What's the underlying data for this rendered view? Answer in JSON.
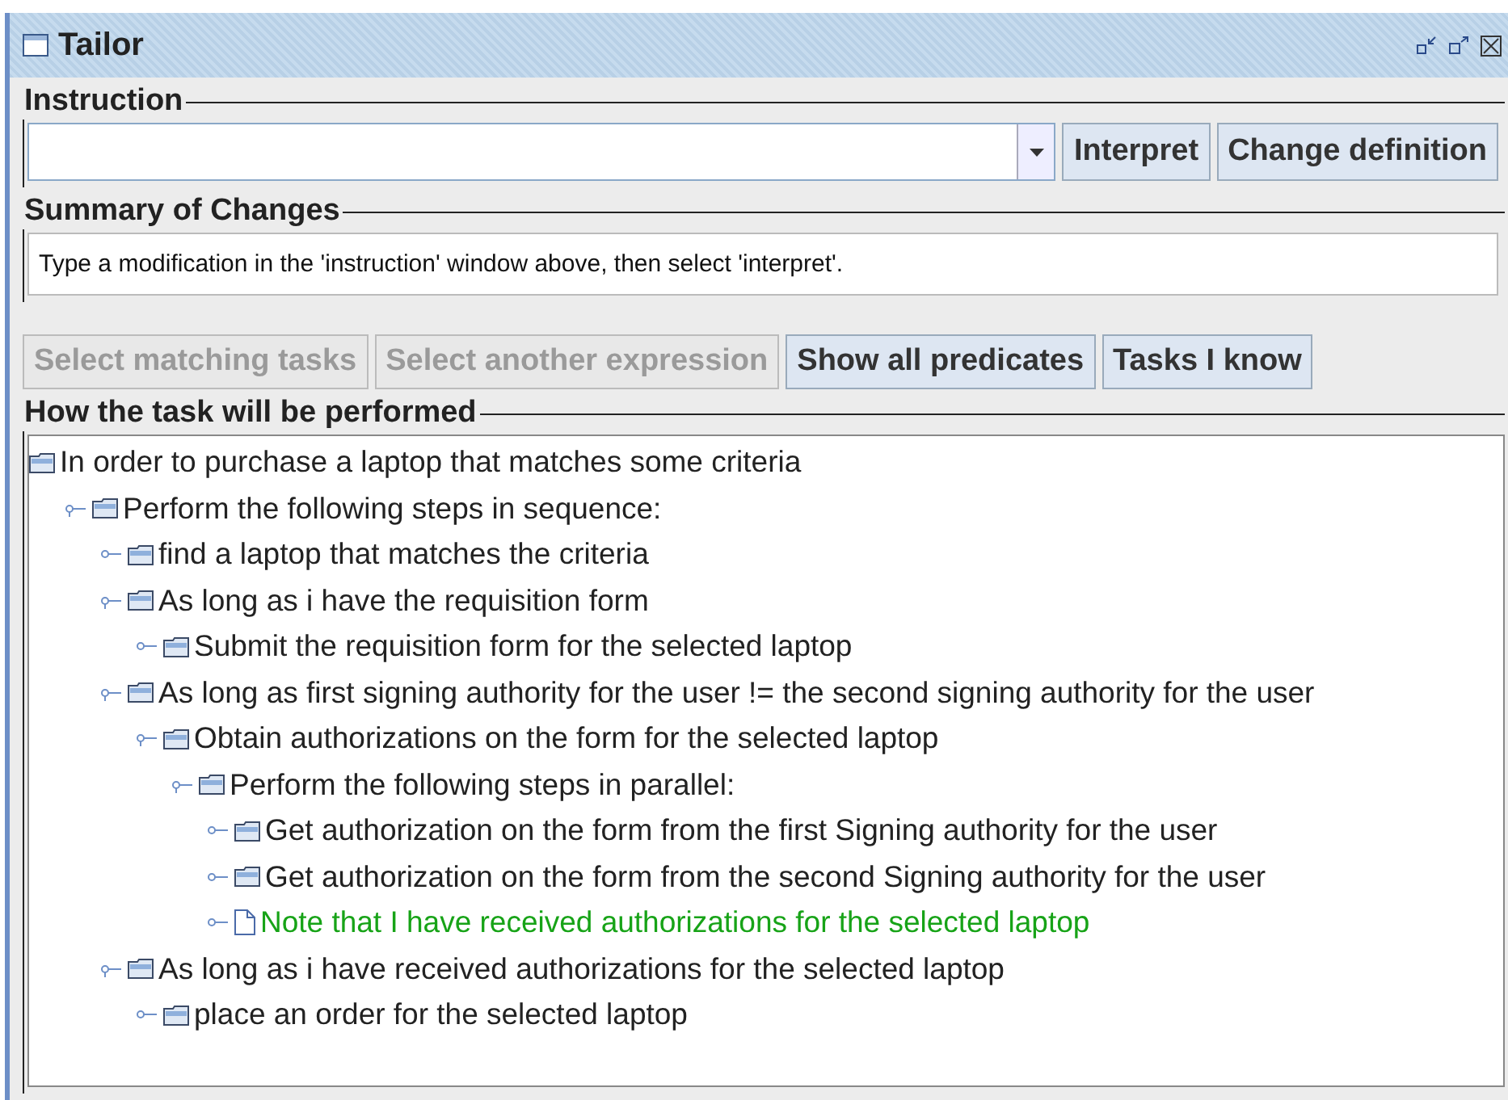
{
  "window": {
    "title": "Tailor"
  },
  "instruction": {
    "label": "Instruction",
    "buttons": [
      {
        "label": "Interpret",
        "disabled": false
      },
      {
        "label": "Change definition",
        "disabled": false
      }
    ]
  },
  "summary": {
    "label": "Summary of Changes",
    "text": "Type a modification in the 'instruction' window above, then select 'interpret'."
  },
  "actions": [
    {
      "label": "Select matching tasks",
      "disabled": true
    },
    {
      "label": "Select another expression",
      "disabled": true
    },
    {
      "label": "Show all predicates",
      "disabled": false
    },
    {
      "label": "Tasks I know",
      "disabled": false
    }
  ],
  "tree": {
    "label": "How the task will be performed",
    "root": {
      "kind": "folder",
      "text": "In order to purchase a laptop that matches some criteria",
      "children": [
        {
          "kind": "folder",
          "text": "Perform the following steps in sequence:",
          "children": [
            {
              "kind": "folder",
              "text": "find a laptop that matches the criteria"
            },
            {
              "kind": "folder",
              "text": "As long as i have the requisition form",
              "children": [
                {
                  "kind": "folder",
                  "text": "Submit the requisition form for the selected laptop"
                }
              ]
            },
            {
              "kind": "folder",
              "text": "As long as first signing authority for the user != the second signing authority for the user",
              "children": [
                {
                  "kind": "folder",
                  "text": "Obtain authorizations on the form for the selected laptop",
                  "children": [
                    {
                      "kind": "folder",
                      "text": "Perform the following steps in parallel:",
                      "children": [
                        {
                          "kind": "folder",
                          "text": "Get authorization on the form from the first Signing authority for the user"
                        },
                        {
                          "kind": "folder",
                          "text": "Get authorization on the form from the second Signing authority for the user"
                        },
                        {
                          "kind": "note",
                          "text": "Note that I have received authorizations for the selected laptop"
                        }
                      ]
                    }
                  ]
                }
              ]
            },
            {
              "kind": "folder",
              "text": "As long as i have received authorizations for the selected laptop",
              "children": [
                {
                  "kind": "folder",
                  "text": "place an order for the selected laptop"
                }
              ]
            }
          ]
        }
      ]
    }
  }
}
